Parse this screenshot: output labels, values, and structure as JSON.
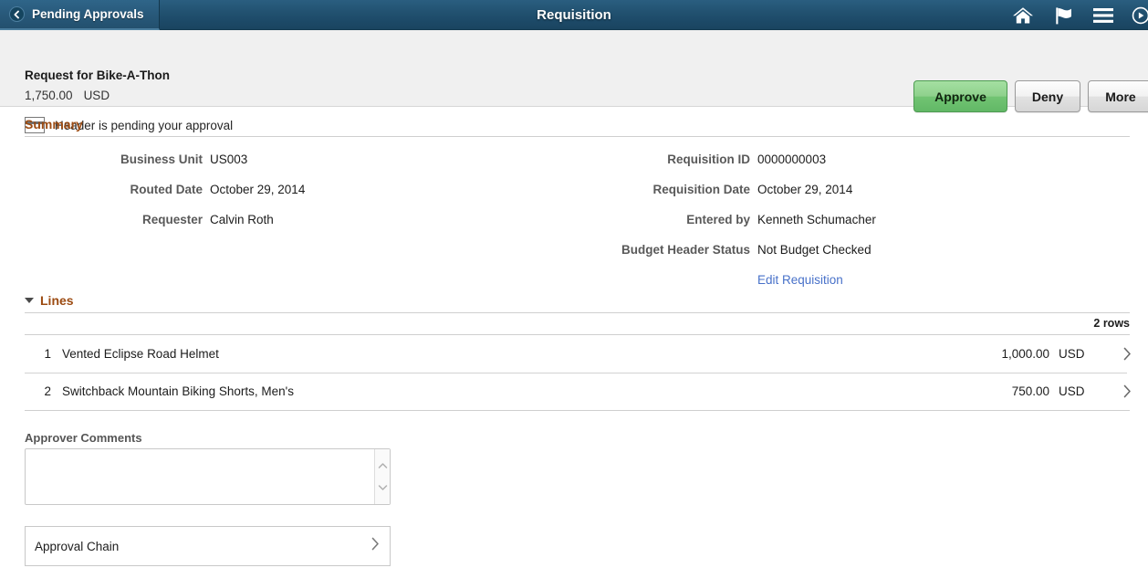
{
  "navbar": {
    "back_label": "Pending Approvals",
    "title": "Requisition",
    "icons": [
      {
        "name": "home-icon"
      },
      {
        "name": "flag-icon"
      },
      {
        "name": "hamburger-menu-icon"
      },
      {
        "name": "actions-circle-icon"
      }
    ]
  },
  "subheader": {
    "title": "Request for Bike-A-Thon",
    "amount": "1,750.00",
    "currency": "USD",
    "status_text": "Header is pending your approval",
    "buttons": {
      "approve": "Approve",
      "deny": "Deny",
      "more": "More"
    }
  },
  "summary": {
    "heading": "Summary",
    "left_fields": [
      {
        "label": "Business Unit",
        "value": "US003"
      },
      {
        "label": "Routed Date",
        "value": "October 29, 2014"
      },
      {
        "label": "Requester",
        "value": "Calvin Roth"
      }
    ],
    "right_fields": [
      {
        "label": "Requisition ID",
        "value": "0000000003"
      },
      {
        "label": "Requisition Date",
        "value": "October 29, 2014"
      },
      {
        "label": "Entered by",
        "value": "Kenneth Schumacher"
      },
      {
        "label": "Budget Header Status",
        "value": "Not Budget Checked"
      }
    ],
    "edit_link": "Edit Requisition"
  },
  "lines": {
    "heading": "Lines",
    "rows_count": "2 rows",
    "items": [
      {
        "num": "1",
        "description": "Vented Eclipse Road Helmet",
        "amount": "1,000.00",
        "currency": "USD"
      },
      {
        "num": "2",
        "description": "Switchback Mountain Biking Shorts, Men's",
        "amount": "750.00",
        "currency": "USD"
      }
    ]
  },
  "comments": {
    "label": "Approver Comments",
    "value": "",
    "placeholder": ""
  },
  "approval_chain": {
    "label": "Approval Chain"
  },
  "colors": {
    "navbar_top": "#2a5e80",
    "navbar_bottom": "#1a4460",
    "section_heading": "#9c4b12",
    "link": "#4871c9",
    "approve_green": "#8ed08c",
    "subheader_bg": "#f0f0f0"
  }
}
